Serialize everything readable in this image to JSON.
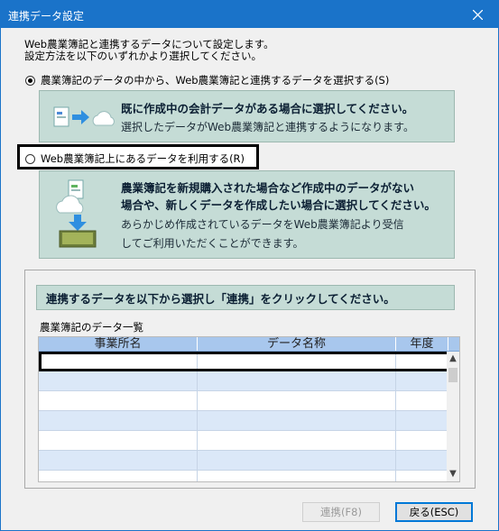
{
  "window": {
    "title": "連携データ設定",
    "close_glyph": "✕"
  },
  "intro": {
    "line1": "Web農業簿記と連携するデータについて設定します。",
    "line2": "設定方法を以下のいずれかより選択してください。"
  },
  "option1": {
    "label": "農業簿記のデータの中から、Web農業簿記と連携するデータを選択する(S)",
    "checked": true,
    "box_head": "既に作成中の会計データがある場合に選択してください。",
    "box_sub": "選択したデータがWeb農業簿記と連携するようになります。"
  },
  "option2": {
    "label": "Web農業簿記上にあるデータを利用する(R)",
    "checked": false,
    "box_head1": "農業簿記を新規購入された場合など作成中のデータがない",
    "box_head2": "場合や、新しくデータを作成したい場合に選択してください。",
    "box_sub1": "あらかじめ作成されているデータをWeb農業簿記より受信",
    "box_sub2": "してご利用いただくことができます。"
  },
  "panel": {
    "heading": "連携するデータを以下から選択し「連携」をクリックしてください。",
    "list_label": "農業簿記のデータ一覧",
    "columns": [
      "事業所名",
      "データ名称",
      "年度"
    ],
    "rows": [
      "",
      "",
      "",
      "",
      "",
      "",
      ""
    ]
  },
  "buttons": {
    "link": "連携(F8)",
    "back": "戻る(ESC)"
  },
  "colors": {
    "titlebar": "#1a73c9",
    "info_box": "#c5dcd6",
    "table_header": "#a8c7ed",
    "table_alt_row": "#dbe8f8"
  }
}
